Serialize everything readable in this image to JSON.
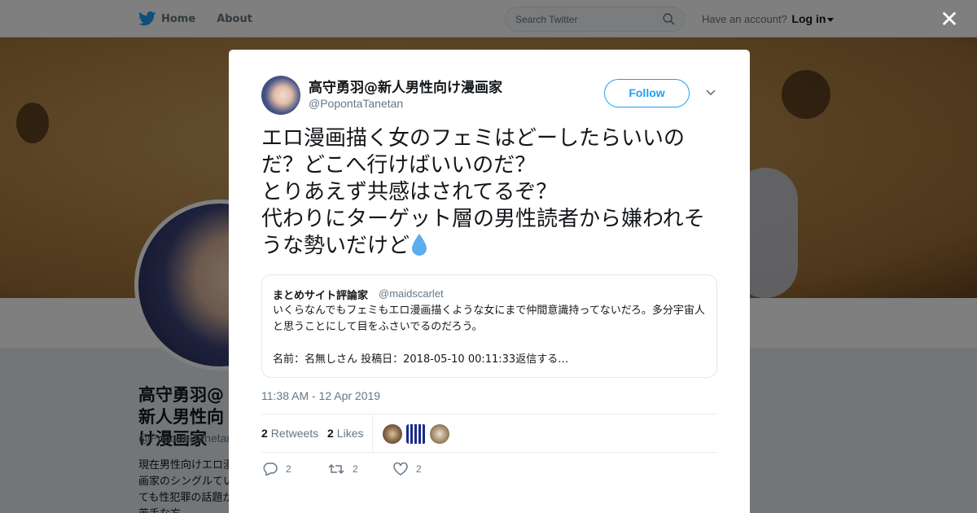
{
  "nav": {
    "home": "Home",
    "about": "About",
    "search_placeholder": "Search Twitter",
    "have_account": "Have an account?",
    "login": "Log in"
  },
  "profile": {
    "name": "高守勇羽@新人男性向け漫画家",
    "handle": "@PopontaTanetan",
    "bio_fragment": "現在男性向けエロ漫画家のシングルていても性犯罪の話題が苦手な方"
  },
  "tweet": {
    "author_name": "高守勇羽@新人男性向け漫画家",
    "author_handle": "@PopontaTanetan",
    "follow_label": "Follow",
    "text": "エロ漫画描く女のフェミはどーしたらいいのだ？どこへ行けばいいのだ？\nとりあえず共感はされてるぞ？\n代わりにターゲット層の男性読者から嫌われそうな勢いだけど",
    "emoji": "droplet-emoji",
    "timestamp": "11:38 AM - 12 Apr 2019",
    "retweets_count": "2",
    "retweets_label": "Retweets",
    "likes_count": "2",
    "likes_label": "Likes",
    "reply_count": "2",
    "retweet_count_action": "2",
    "like_count_action": "2"
  },
  "quote": {
    "name": "まとめサイト評論家",
    "handle": "@maidscarlet",
    "text": "いくらなんでもフェミもエロ漫画描くような女にまで仲間意識持ってないだろ。多分宇宙人と思うことにして目をふさいでるのだろう。\n\n名前：名無しさん 投稿日：2018-05-10 00:11:33返信する…"
  },
  "colors": {
    "twitter_blue": "#1da1f2",
    "text_primary": "#14171a",
    "text_secondary": "#657786",
    "overlay": "rgba(0,0,0,0.5)"
  }
}
